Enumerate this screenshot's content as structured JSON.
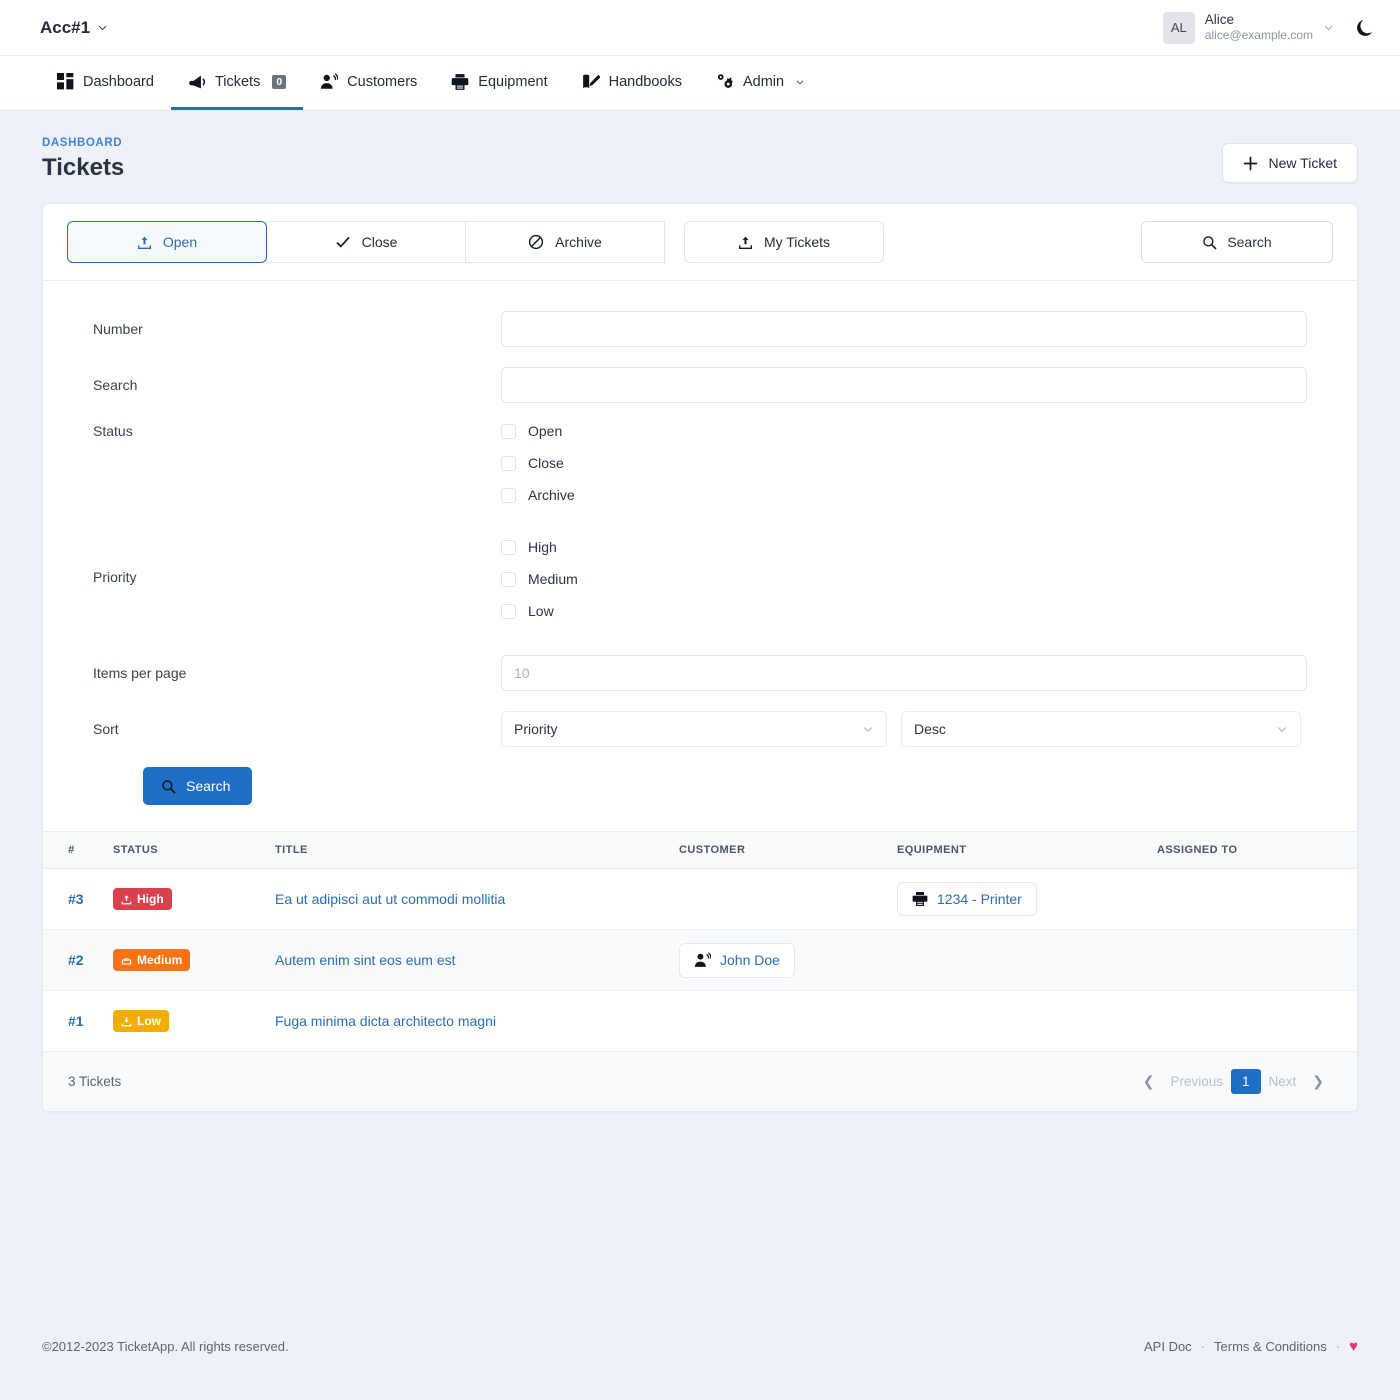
{
  "topbar": {
    "account_label": "Acc#1",
    "account_chevron": "chevron-down",
    "user": {
      "initials": "AL",
      "name": "Alice",
      "email": "alice@example.com"
    },
    "theme_toggle_icon": "moon-icon"
  },
  "nav": {
    "items": [
      {
        "label": "Dashboard",
        "icon": "grid-icon",
        "active": false,
        "badge": null,
        "caret": false
      },
      {
        "label": "Tickets",
        "icon": "megaphone-icon",
        "active": true,
        "badge": "0",
        "caret": false
      },
      {
        "label": "Customers",
        "icon": "person-voice-icon",
        "active": false,
        "badge": null,
        "caret": false
      },
      {
        "label": "Equipment",
        "icon": "printer-icon",
        "active": false,
        "badge": null,
        "caret": false
      },
      {
        "label": "Handbooks",
        "icon": "book-pen-icon",
        "active": false,
        "badge": null,
        "caret": false
      },
      {
        "label": "Admin",
        "icon": "gears-icon",
        "active": false,
        "badge": null,
        "caret": true
      }
    ]
  },
  "page": {
    "breadcrumb": "DASHBOARD",
    "title": "Tickets",
    "new_ticket_label": "New Ticket"
  },
  "tabs": {
    "open": "Open",
    "close": "Close",
    "archive": "Archive",
    "my_tickets": "My Tickets",
    "search": "Search"
  },
  "form": {
    "number_label": "Number",
    "number_value": "",
    "number_placeholder": "",
    "search_label": "Search",
    "search_value": "",
    "search_placeholder": "",
    "status_label": "Status",
    "status_options": [
      "Open",
      "Close",
      "Archive"
    ],
    "priority_label": "Priority",
    "priority_options": [
      "High",
      "Medium",
      "Low"
    ],
    "items_per_page_label": "Items per page",
    "items_per_page_value": "",
    "items_per_page_placeholder": "10",
    "sort_label": "Sort",
    "sort_field_value": "Priority",
    "sort_dir_value": "Desc",
    "submit_label": "Search"
  },
  "table": {
    "columns": [
      "#",
      "STATUS",
      "TITLE",
      "CUSTOMER",
      "EQUIPMENT",
      "ASSIGNED TO"
    ],
    "rows": [
      {
        "number": "#3",
        "priority": "High",
        "priority_color": "#d9414d",
        "priority_icon": "upload-icon",
        "title": "Ea ut adipisci aut ut commodi mollitia",
        "customer": "",
        "customer_icon": "",
        "equipment": "1234 - Printer",
        "equipment_icon": "printer-icon",
        "assigned_to": ""
      },
      {
        "number": "#2",
        "priority": "Medium",
        "priority_color": "#f97316",
        "priority_icon": "tray-icon",
        "title": "Autem enim sint eos eum est",
        "customer": "John Doe",
        "customer_icon": "person-voice-icon",
        "equipment": "",
        "equipment_icon": "",
        "assigned_to": ""
      },
      {
        "number": "#1",
        "priority": "Low",
        "priority_color": "#f2ad00",
        "priority_icon": "download-icon",
        "title": "Fuga minima dicta architecto magni",
        "customer": "",
        "customer_icon": "",
        "equipment": "",
        "equipment_icon": "",
        "assigned_to": ""
      }
    ],
    "count_label": "3 Tickets",
    "pagination": {
      "previous": "Previous",
      "current_page": "1",
      "next": "Next"
    }
  },
  "footer": {
    "copyright": "©2012-2023 TicketApp. All rights reserved.",
    "api_doc": "API Doc",
    "dot1": "·",
    "terms": "Terms & Conditions",
    "dot2": "·",
    "heart": "♥"
  },
  "colors": {
    "accent": "#2b6cb8",
    "primary_button": "#1f6fc4",
    "page_bg": "#eef1f7",
    "high": "#d9414d",
    "medium": "#f97316",
    "low": "#f2ad00",
    "heart": "#e23670"
  }
}
